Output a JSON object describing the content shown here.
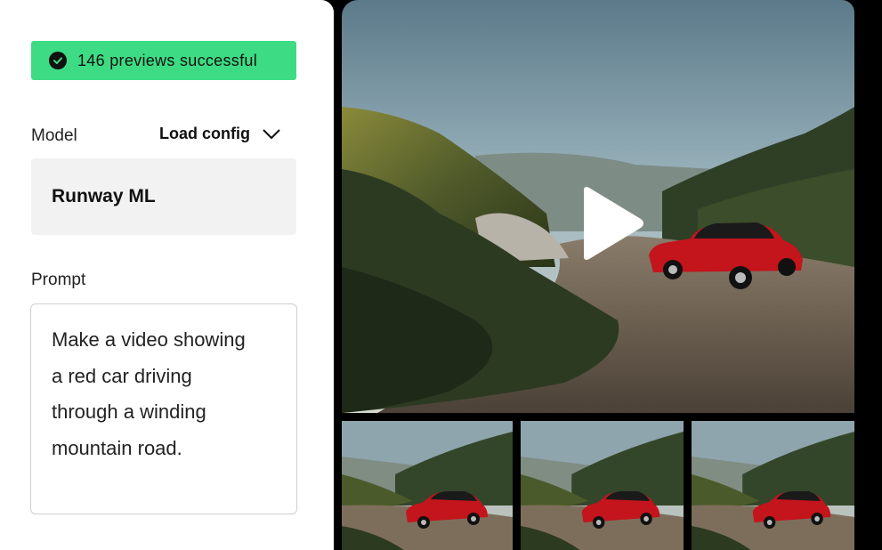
{
  "toast": {
    "text": "146 previews successful",
    "icon": "check-circle-icon",
    "color": "#3ddc84"
  },
  "model": {
    "label": "Model",
    "load_config_label": "Load config",
    "value": "Runway ML"
  },
  "prompt": {
    "label": "Prompt",
    "lines": [
      "Make a video showing",
      "a red car driving",
      "through a winding",
      "mountain road."
    ]
  },
  "video": {
    "play_icon": "play-icon",
    "accent_car_color": "#c4141c"
  },
  "thumbnails": [
    {
      "id": "thumb-1"
    },
    {
      "id": "thumb-2"
    },
    {
      "id": "thumb-3"
    }
  ]
}
